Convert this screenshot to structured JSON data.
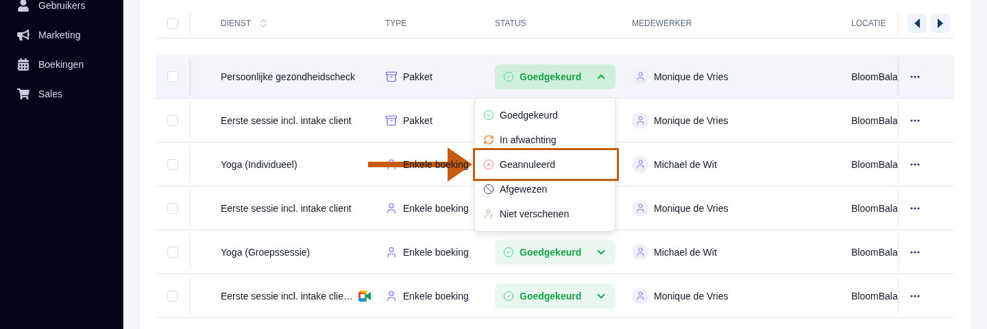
{
  "sidebar": {
    "items": [
      {
        "label": "Gebruikers"
      },
      {
        "label": "Marketing"
      },
      {
        "label": "Boekingen"
      },
      {
        "label": "Sales"
      }
    ]
  },
  "table": {
    "select_all": {
      "checked": false
    },
    "columns": [
      {
        "label": "DIENST",
        "sortable": true
      },
      {
        "label": "TYPE",
        "sortable": false
      },
      {
        "label": "STATUS",
        "sortable": false
      },
      {
        "label": "MEDEWERKER",
        "sortable": false
      },
      {
        "label": "LOCATIE",
        "sortable": false
      }
    ],
    "rows": [
      {
        "checked": false,
        "highlighted": true,
        "service": "Persoonlijke gezondheidscheck",
        "video": false,
        "type": {
          "kind": "package",
          "label": "Pakket"
        },
        "status": {
          "label": "Goedgekeurd",
          "kind": "approved",
          "expanded": true
        },
        "employee": "Monique de Vries",
        "location": "BloomBala"
      },
      {
        "checked": false,
        "highlighted": false,
        "service": "Eerste sessie incl. intake client",
        "video": false,
        "type": {
          "kind": "package",
          "label": "Pakket"
        },
        "employee": "Monique de Vries",
        "location": "BloomBala"
      },
      {
        "checked": false,
        "highlighted": false,
        "service": "Yoga (Individueel)",
        "video": false,
        "type": {
          "kind": "single",
          "label": "Enkele boeking"
        },
        "employee": "Michael de Wit",
        "location": "BloomBala"
      },
      {
        "checked": false,
        "highlighted": false,
        "service": "Eerste sessie incl. intake client",
        "video": false,
        "type": {
          "kind": "single",
          "label": "Enkele boeking"
        },
        "employee": "Monique de Vries",
        "location": "BloomBala"
      },
      {
        "checked": false,
        "highlighted": false,
        "service": "Yoga (Groepssessie)",
        "video": false,
        "type": {
          "kind": "single",
          "label": "Enkele boeking"
        },
        "status": {
          "label": "Goedgekeurd",
          "kind": "approved",
          "expanded": false
        },
        "employee": "Michael de Wit",
        "location": "BloomBala"
      },
      {
        "checked": false,
        "highlighted": false,
        "service": "Eerste sessie incl. intake clie…",
        "video": true,
        "type": {
          "kind": "single",
          "label": "Enkele boeking"
        },
        "status": {
          "label": "Goedgekeurd",
          "kind": "approved",
          "expanded": false
        },
        "employee": "Monique de Vries",
        "location": "BloomBala"
      }
    ]
  },
  "status_menu": {
    "items": [
      {
        "label": "Goedgekeurd",
        "kind": "approved",
        "highlighted": false
      },
      {
        "label": "In afwachting",
        "kind": "pending",
        "highlighted": false
      },
      {
        "label": "Geannuleerd",
        "kind": "cancelled",
        "highlighted": true
      },
      {
        "label": "Afgewezen",
        "kind": "rejected",
        "highlighted": false
      },
      {
        "label": "Niet verschenen",
        "kind": "no_show",
        "highlighted": false
      }
    ]
  }
}
